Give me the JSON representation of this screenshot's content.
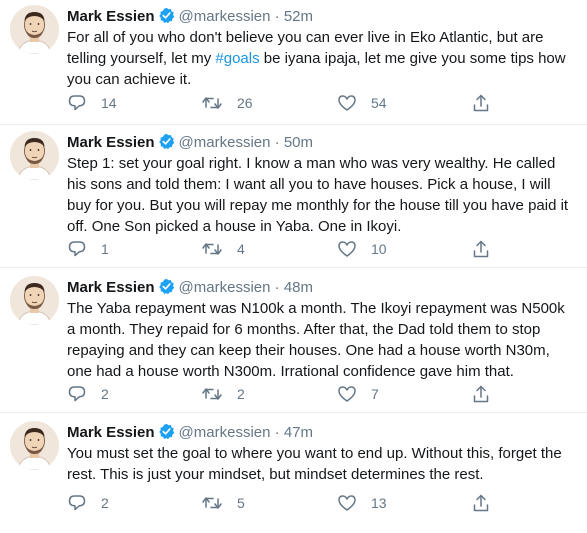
{
  "tweets": [
    {
      "name": "Mark Essien",
      "handle": "@markessien",
      "time": "52m",
      "text_before": "For all of you who don't believe you can ever live in Eko Atlantic, but are telling yourself, let my ",
      "hashtag": "#goals",
      "text_after": " be iyana ipaja, let me give you some tips how you can achieve it.",
      "replies": "14",
      "retweets": "26",
      "likes": "54"
    },
    {
      "name": "Mark Essien",
      "handle": "@markessien",
      "time": "50m",
      "text": "Step 1: set your goal right. I know a man who was very wealthy. He called his sons and told them: I want all you to have houses. Pick a house, I will buy for you. But you will repay me monthly for the house till you have paid it off. One Son picked a house in Yaba. One in Ikoyi.",
      "replies": "1",
      "retweets": "4",
      "likes": "10"
    },
    {
      "name": "Mark Essien",
      "handle": "@markessien",
      "time": "48m",
      "text": "The Yaba repayment was N100k a month. The Ikoyi repayment was N500k a month. They repaid for 6 months. After that, the Dad told them to stop repaying and they can keep their houses. One had a house worth N30m, one had a house worth N300m. Irrational confidence gave him that.",
      "replies": "2",
      "retweets": "2",
      "likes": "7"
    },
    {
      "name": "Mark Essien",
      "handle": "@markessien",
      "time": "47m",
      "text": "You must set the goal to where you want to end up. Without this, forget the rest. This is just your mindset, but mindset determines the rest.",
      "replies": "2",
      "retweets": "5",
      "likes": "13"
    }
  ],
  "time_separator": "·",
  "icons": {
    "verified": "verified-badge-icon",
    "reply": "reply-icon",
    "retweet": "retweet-icon",
    "like": "heart-icon",
    "share": "share-icon"
  },
  "colors": {
    "verified": "#1da1f2",
    "hashtag": "#1b95e0",
    "muted": "#657786",
    "divider": "#e6ecf0"
  }
}
